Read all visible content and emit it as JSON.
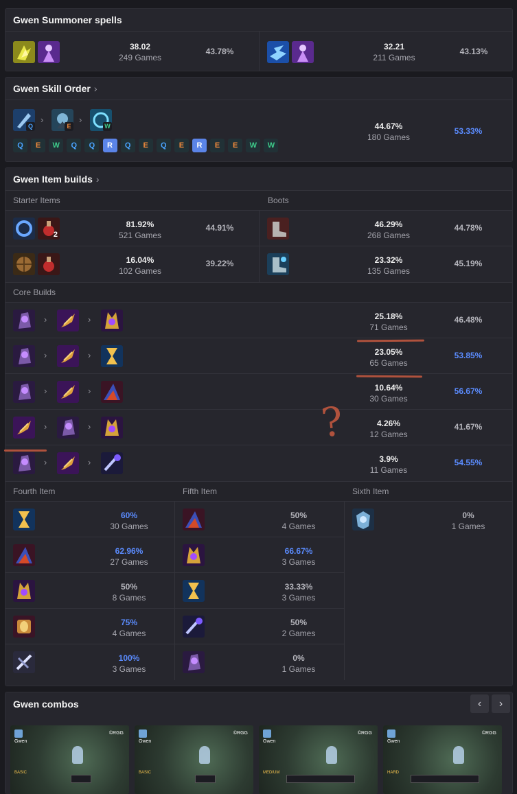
{
  "summoner": {
    "title": "Gwen Summoner spells",
    "rows": [
      {
        "pick": "38.02",
        "games": "249 Games",
        "win": "43.78%"
      },
      {
        "pick": "32.21",
        "games": "211 Games",
        "win": "43.13%"
      }
    ]
  },
  "skill": {
    "title": "Gwen Skill Order",
    "chevron": "›",
    "priority": [
      "Q",
      "E",
      "W"
    ],
    "sequence": [
      "Q",
      "E",
      "W",
      "Q",
      "Q",
      "R",
      "Q",
      "E",
      "Q",
      "E",
      "R",
      "E",
      "E",
      "W",
      "W"
    ],
    "pick": "44.67%",
    "games": "180 Games",
    "win": "53.33%"
  },
  "items": {
    "title": "Gwen Item builds",
    "chevron": "›",
    "starter_label": "Starter Items",
    "boots_label": "Boots",
    "core_label": "Core Builds",
    "starter": [
      {
        "pick": "81.92%",
        "games": "521 Games",
        "win": "44.91%",
        "count": "2"
      },
      {
        "pick": "16.04%",
        "games": "102 Games",
        "win": "39.22%"
      }
    ],
    "boots": [
      {
        "pick": "46.29%",
        "games": "268 Games",
        "win": "44.78%"
      },
      {
        "pick": "23.32%",
        "games": "135 Games",
        "win": "45.19%"
      }
    ],
    "core": [
      {
        "pick": "25.18%",
        "games": "71 Games",
        "win": "46.48%"
      },
      {
        "pick": "23.05%",
        "games": "65 Games",
        "win": "53.85%"
      },
      {
        "pick": "10.64%",
        "games": "30 Games",
        "win": "56.67%"
      },
      {
        "pick": "4.26%",
        "games": "12 Games",
        "win": "41.67%"
      },
      {
        "pick": "3.9%",
        "games": "11 Games",
        "win": "54.55%"
      }
    ],
    "fourth_label": "Fourth Item",
    "fifth_label": "Fifth Item",
    "sixth_label": "Sixth Item",
    "fourth": [
      {
        "win": "60%",
        "games": "30 Games"
      },
      {
        "win": "62.96%",
        "games": "27 Games"
      },
      {
        "win": "50%",
        "games": "8 Games"
      },
      {
        "win": "75%",
        "games": "4 Games"
      },
      {
        "win": "100%",
        "games": "3 Games"
      }
    ],
    "fifth": [
      {
        "win": "50%",
        "games": "4 Games"
      },
      {
        "win": "66.67%",
        "games": "3 Games"
      },
      {
        "win": "33.33%",
        "games": "3 Games"
      },
      {
        "win": "50%",
        "games": "2 Games"
      },
      {
        "win": "0%",
        "games": "1 Games"
      }
    ],
    "sixth": [
      {
        "win": "0%",
        "games": "1 Games"
      }
    ]
  },
  "combos": {
    "title": "Gwen combos",
    "prev": "‹",
    "next": "›",
    "cards": [
      {
        "champ": "Gwen",
        "brand": "©RGG",
        "level": "BASIC"
      },
      {
        "champ": "Gwen",
        "brand": "©RGG",
        "level": "BASIC"
      },
      {
        "champ": "Gwen",
        "brand": "©RGG",
        "level": "MEDIUM"
      },
      {
        "champ": "Gwen",
        "brand": "©RGG",
        "level": "HARD"
      }
    ]
  },
  "annotation": {
    "mark": "?"
  },
  "colors": {
    "accent_blue": "#5b8cff",
    "annotation_red": "#b0523d"
  }
}
